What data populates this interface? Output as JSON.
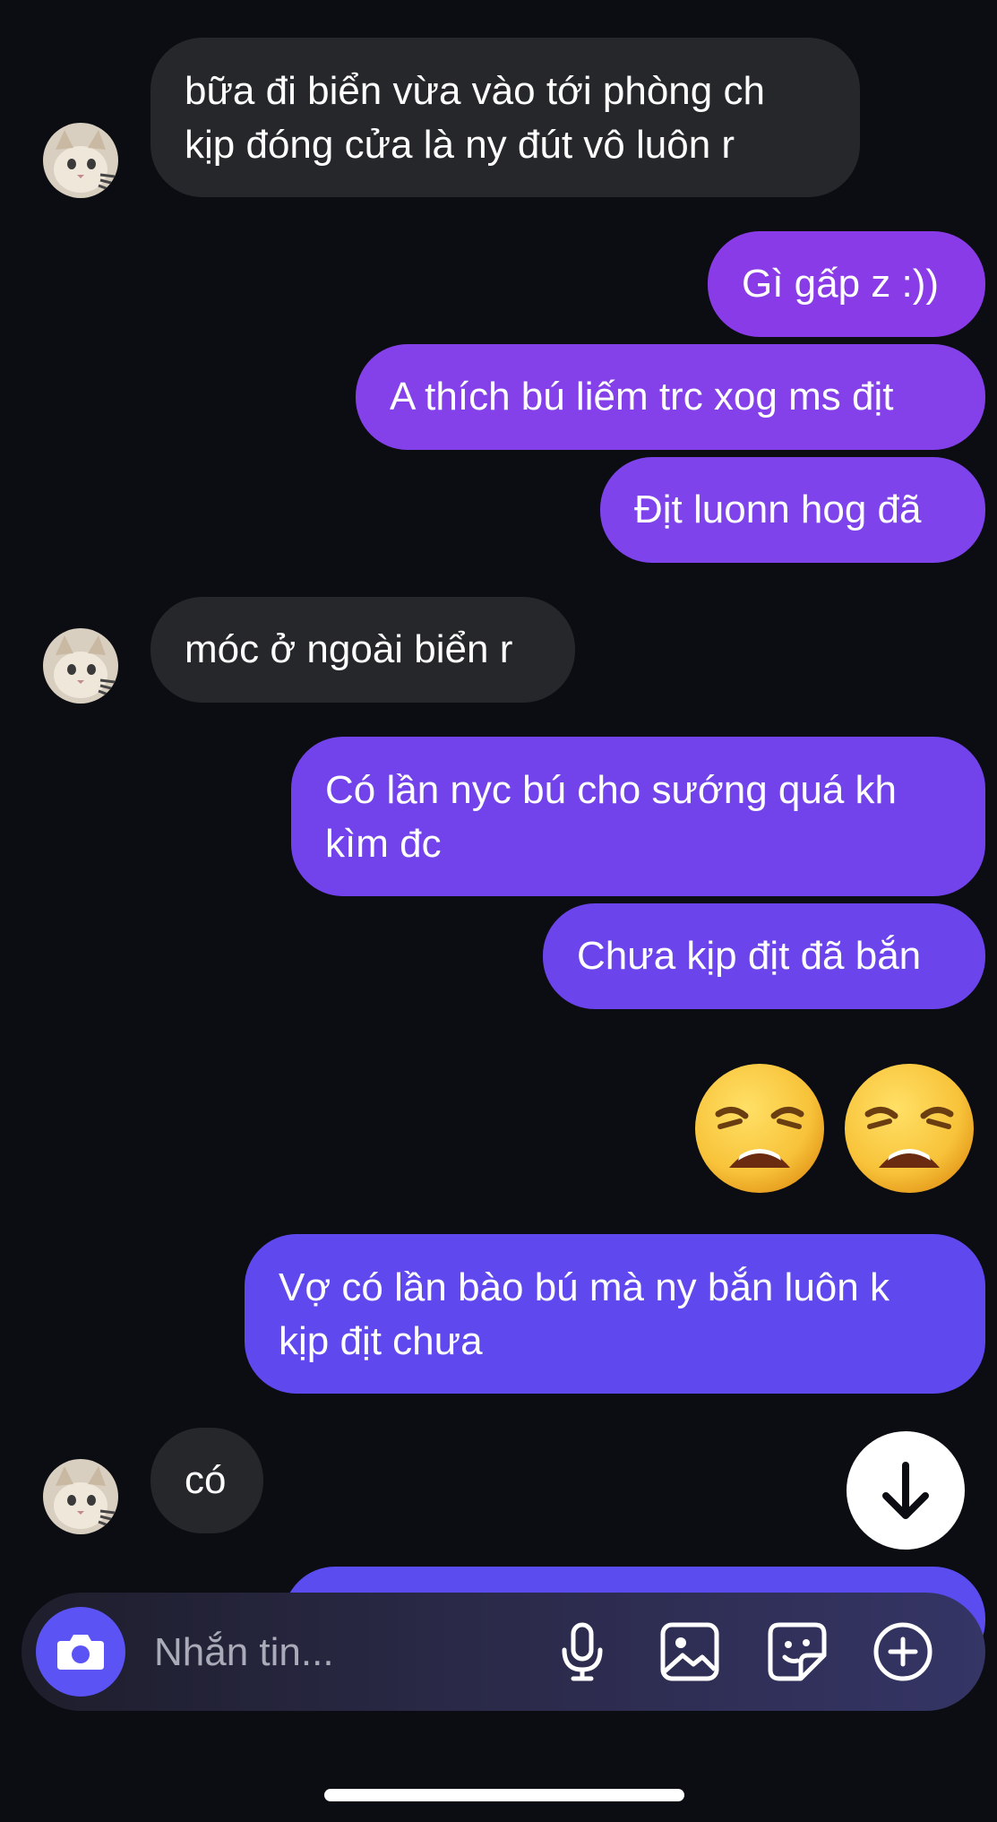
{
  "messages": [
    {
      "from": "them",
      "lines": [
        "bữa đi biển vừa vào tới phòng ch",
        "kịp đóng cửa là ny đút vô luôn r"
      ]
    },
    {
      "from": "me",
      "text": "Gì gấp z :))"
    },
    {
      "from": "me",
      "text": "A thích bú liếm trc xog ms địt"
    },
    {
      "from": "me",
      "text": "Địt luonn hog đã"
    },
    {
      "from": "them",
      "text": "móc ở ngoài biển r"
    },
    {
      "from": "me",
      "lines": [
        "Có lần nyc bú cho sướng quá kh",
        "kìm đc"
      ]
    },
    {
      "from": "me",
      "text": "Chưa kịp địt đã bắn"
    },
    {
      "from": "me",
      "emoji": [
        "weary-face",
        "weary-face"
      ]
    },
    {
      "from": "me",
      "lines": [
        "Vợ có lần bào bú mà ny bắn luôn k",
        "kịp địt chưa"
      ]
    },
    {
      "from": "them",
      "text": "có"
    }
  ],
  "composer": {
    "placeholder": "Nhắn tin...",
    "icons": [
      "camera-icon",
      "microphone-icon",
      "image-icon",
      "sticker-icon",
      "plus-icon"
    ]
  },
  "colors": {
    "background": "#0c0d12",
    "received_bubble": "#25272b",
    "sent_gradient_top": "#8a3be8",
    "sent_gradient_bottom": "#5948ee",
    "accent": "#5b53f4"
  }
}
